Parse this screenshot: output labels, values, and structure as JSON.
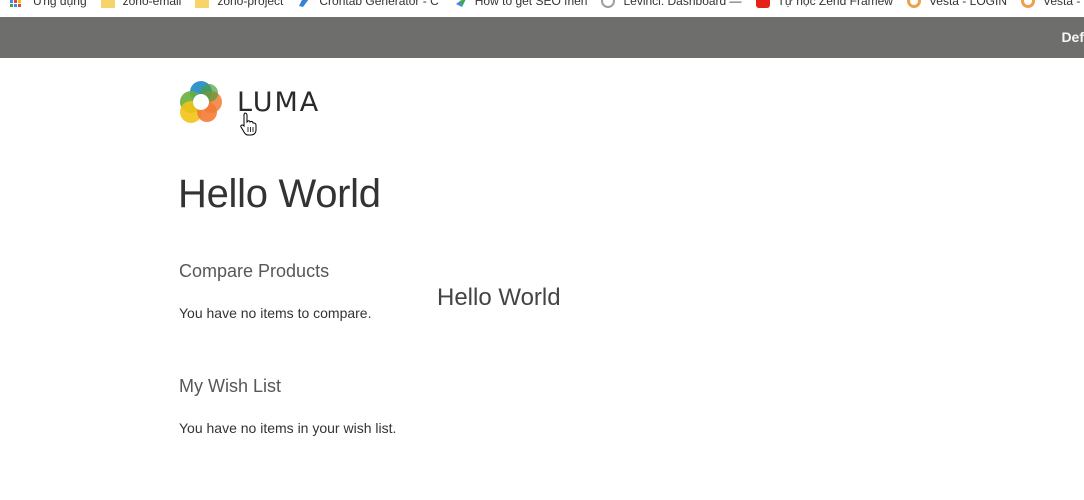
{
  "bookmarks": [
    {
      "label": "Ứng dụng",
      "icon": "apps-grid-icon"
    },
    {
      "label": "zoho-email",
      "icon": "folder-icon"
    },
    {
      "label": "zoho-project",
      "icon": "folder-icon"
    },
    {
      "label": "Crontab Generator - C",
      "icon": "crontab-icon"
    },
    {
      "label": "How to get SEO frien",
      "icon": "seo-icon"
    },
    {
      "label": "Levinci: Dashboard —",
      "icon": "levinci-icon"
    },
    {
      "label": "Tự học Zend Framew",
      "icon": "youtube-icon"
    },
    {
      "label": "Vesta - LOGIN",
      "icon": "vesta-icon"
    },
    {
      "label": "Vesta - B",
      "icon": "vesta-icon"
    }
  ],
  "header": {
    "switcher_label": "Def"
  },
  "logo": {
    "text": "LUMA"
  },
  "main": {
    "page_title": "Hello World",
    "content_text": "Hello World"
  },
  "sidebar": {
    "compare": {
      "title": "Compare Products",
      "empty": "You have no items to compare."
    },
    "wishlist": {
      "title": "My Wish List",
      "empty": "You have no items in your wish list."
    }
  },
  "colors": {
    "header_bg": "#6e6e6c",
    "logo_blue": "#1e88c8",
    "logo_green": "#6aae3a",
    "logo_yellow": "#f2c318",
    "logo_orange": "#f27b35"
  }
}
